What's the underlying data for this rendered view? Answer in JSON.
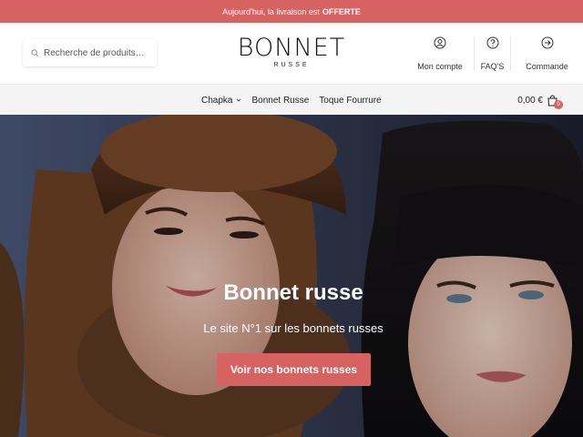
{
  "announcement": {
    "text": "Aujourd'hui, la livraison est",
    "highlight": "OFFERTE"
  },
  "search": {
    "placeholder": "Recherche de produits…",
    "icon": "search-icon"
  },
  "logo": {
    "main": "BONNET",
    "sub": "RUSSE"
  },
  "header_links": [
    {
      "label": "Mon compte",
      "icon": "user-icon"
    },
    {
      "label": "FAQ'S",
      "icon": "help-icon"
    },
    {
      "label": "Commande",
      "icon": "arrow-right-circle-icon"
    }
  ],
  "menu": [
    {
      "label": "Chapka",
      "has_dropdown": true
    },
    {
      "label": "Bonnet Russe",
      "has_dropdown": false
    },
    {
      "label": "Toque Fourrure",
      "has_dropdown": false
    }
  ],
  "cart": {
    "total": "0,00 €",
    "count": "0",
    "icon": "shopping-bag-icon"
  },
  "hero": {
    "title": "Bonnet russe",
    "subtitle": "Le site N°1 sur les bonnets russes",
    "button_label": "Voir nos bonnets russes"
  },
  "colors": {
    "accent": "#d66262",
    "menu_bg": "#f4f4f4",
    "white": "#ffffff"
  }
}
